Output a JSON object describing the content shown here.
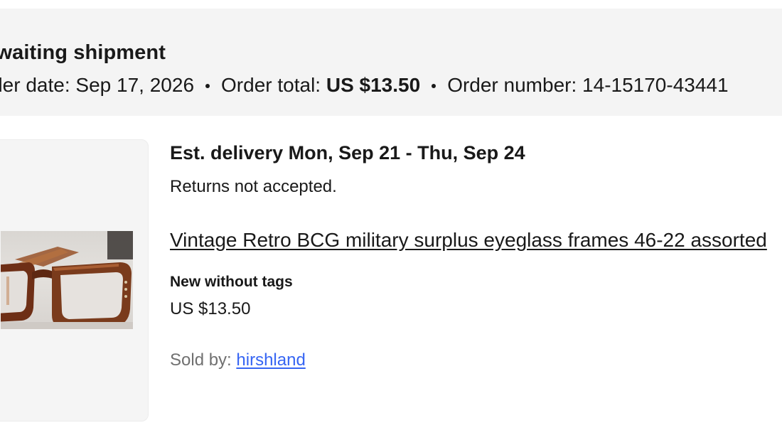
{
  "header": {
    "status": "Awaiting shipment",
    "order_date_label": "Order date:",
    "order_date": "Sep 17, 2026",
    "order_total_label": "Order total:",
    "order_total": "US $13.50",
    "order_number_label": "Order number:",
    "order_number": "14-15170-43441"
  },
  "item": {
    "est_delivery": "Est. delivery Mon, Sep 21 - Thu, Sep 24",
    "returns": "Returns not accepted.",
    "title": "Vintage Retro BCG military surplus eyeglass frames 46-22 assorted",
    "condition": "New without tags",
    "price": "US $13.50",
    "sold_by_label": "Sold by:",
    "seller": "hirshland",
    "image_icon": "eyeglasses-photo"
  },
  "colors": {
    "header_bg": "#f4f4f4",
    "link_blue": "#3665f3",
    "muted_text": "#707070",
    "frame_brown": "#7a3b1c"
  }
}
